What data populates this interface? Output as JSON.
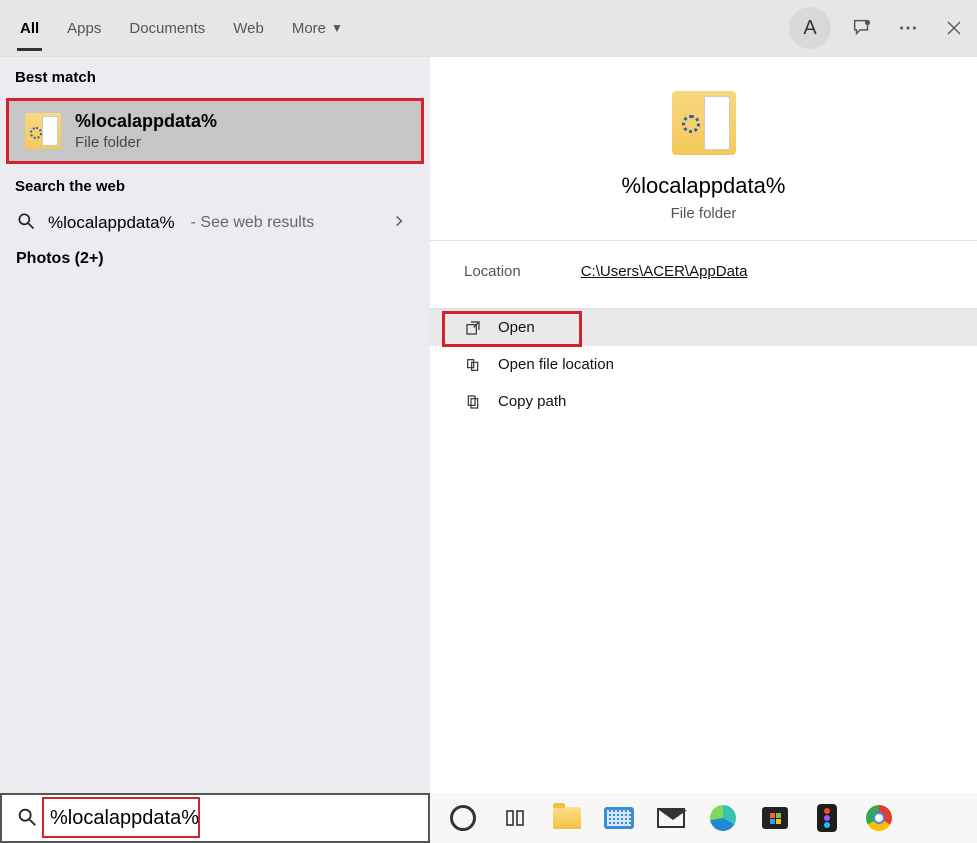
{
  "tabs": {
    "all": "All",
    "apps": "Apps",
    "documents": "Documents",
    "web": "Web",
    "more": "More"
  },
  "avatar_letter": "A",
  "sections": {
    "best_match": "Best match",
    "search_web": "Search the web",
    "photos": "Photos (2+)"
  },
  "best_match": {
    "title": "%localappdata%",
    "subtitle": "File folder"
  },
  "web_result": {
    "query": "%localappdata%",
    "tail": " - See web results"
  },
  "preview": {
    "title": "%localappdata%",
    "subtitle": "File folder",
    "location_label": "Location",
    "location_path": "C:\\Users\\ACER\\AppData"
  },
  "actions": {
    "open": "Open",
    "open_loc": "Open file location",
    "copy_path": "Copy path"
  },
  "search_value": "%localappdata%"
}
